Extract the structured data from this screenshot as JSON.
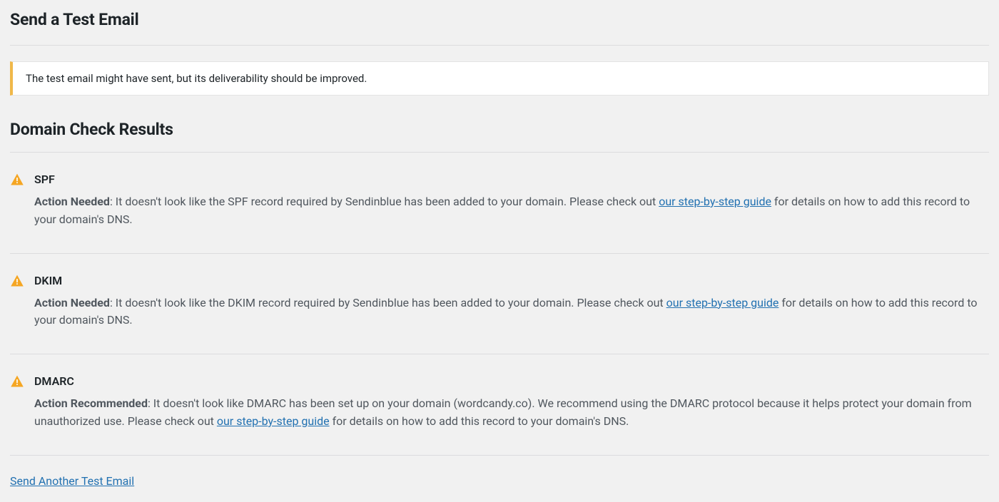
{
  "page": {
    "title": "Send a Test Email"
  },
  "notice": {
    "message": "The test email might have sent, but its deliverability should be improved."
  },
  "results": {
    "heading": "Domain Check Results",
    "items": [
      {
        "name": "SPF",
        "action_label": "Action Needed",
        "desc_before": ": It doesn't look like the SPF record required by Sendinblue has been added to your domain. Please check out ",
        "link_text": "our step-by-step guide",
        "desc_after": " for details on how to add this record to your domain's DNS."
      },
      {
        "name": "DKIM",
        "action_label": "Action Needed",
        "desc_before": ": It doesn't look like the DKIM record required by Sendinblue has been added to your domain. Please check out ",
        "link_text": "our step-by-step guide",
        "desc_after": " for details on how to add this record to your domain's DNS."
      },
      {
        "name": "DMARC",
        "action_label": "Action Recommended",
        "desc_before": ": It doesn't look like DMARC has been set up on your domain (wordcandy.co). We recommend using the DMARC protocol because it helps protect your domain from unauthorized use. Please check out ",
        "link_text": "our step-by-step guide",
        "desc_after": " for details on how to add this record to your domain's DNS."
      }
    ]
  },
  "footer": {
    "send_another": "Send Another Test Email"
  }
}
